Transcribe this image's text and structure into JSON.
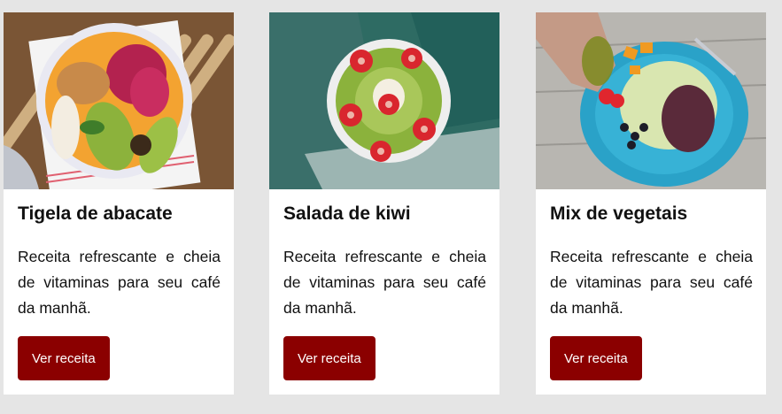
{
  "cards": [
    {
      "title": "Tigela de abacate",
      "description": "Receita refrescante e cheia de vitaminas para seu café da manhã.",
      "button": "Ver receita"
    },
    {
      "title": "Salada de kiwi",
      "description": "Receita refrescante e cheia de vitaminas para seu café da manhã.",
      "button": "Ver receita"
    },
    {
      "title": "Mix de vegetais",
      "description": "Receita refrescante e cheia de vitaminas para seu café da manhã.",
      "button": "Ver receita"
    }
  ],
  "colors": {
    "button_bg": "#8b0000",
    "page_bg": "#e5e5e5",
    "card_bg": "#ffffff"
  }
}
